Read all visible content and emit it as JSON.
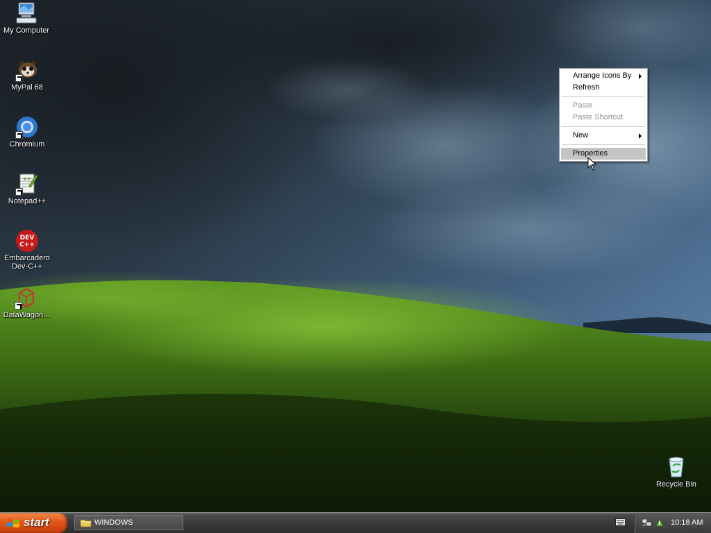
{
  "desktop": {
    "icons": [
      {
        "label": "My Computer",
        "icon": "my-computer-icon"
      },
      {
        "label": "MyPal 68",
        "icon": "mypal-icon",
        "shortcut": true
      },
      {
        "label": "Chromium",
        "icon": "chromium-icon",
        "shortcut": true
      },
      {
        "label": "Notepad++",
        "icon": "notepad-plus-plus-icon",
        "shortcut": true
      },
      {
        "label": "Embarcadero\nDev-C++",
        "icon": "dev-cpp-icon"
      },
      {
        "label": "DataWagon...",
        "icon": "datawagon-icon",
        "shortcut": true
      },
      {
        "label": "Recycle Bin",
        "icon": "recycle-bin-icon"
      }
    ]
  },
  "context_menu": {
    "items": [
      {
        "label": "Arrange Icons By",
        "submenu": true,
        "enabled": true
      },
      {
        "label": "Refresh",
        "enabled": true
      },
      {
        "label": "Paste",
        "enabled": false
      },
      {
        "label": "Paste Shortcut",
        "enabled": false
      },
      {
        "label": "New",
        "submenu": true,
        "enabled": true
      },
      {
        "label": "Properties",
        "enabled": true,
        "selected": true
      }
    ]
  },
  "taskbar": {
    "start_label": "start",
    "tasks": [
      {
        "label": "WINDOWS",
        "icon": "folder-icon"
      }
    ],
    "tray": {
      "icons": [
        "keyboard-icon",
        "network-icon",
        "safely-remove-hardware-icon"
      ],
      "clock": "10:18 AM"
    }
  },
  "colors": {
    "start_button": "#e2561a",
    "taskbar": "#3a3a3a",
    "menu_highlight": "#c4c4c4",
    "sky": "#2f4a66",
    "hill": "#4f8a1a"
  }
}
